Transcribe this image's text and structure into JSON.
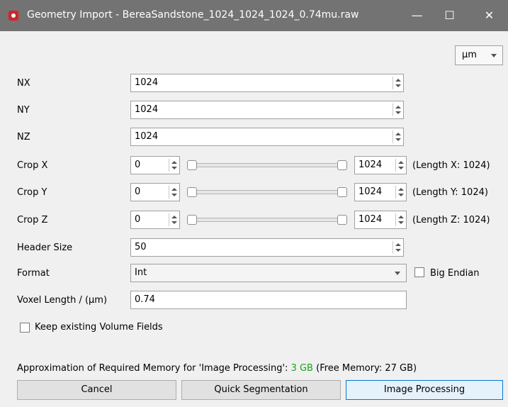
{
  "window": {
    "title": "Geometry Import - BereaSandstone_1024_1024_1024_0.74mu.raw",
    "minimize_glyph": "—",
    "maximize_glyph": "☐",
    "close_glyph": "✕"
  },
  "unit_select": {
    "value": "μm"
  },
  "dims": [
    {
      "label": "NX",
      "value": "1024"
    },
    {
      "label": "NY",
      "value": "1024"
    },
    {
      "label": "NZ",
      "value": "1024"
    }
  ],
  "crops": [
    {
      "label": "Crop X",
      "start": "0",
      "end": "1024",
      "length_text": "(Length X: 1024)",
      "range": [
        0,
        1024
      ],
      "max": 1024
    },
    {
      "label": "Crop Y",
      "start": "0",
      "end": "1024",
      "length_text": "(Length Y: 1024)",
      "range": [
        0,
        1024
      ],
      "max": 1024
    },
    {
      "label": "Crop Z",
      "start": "0",
      "end": "1024",
      "length_text": "(Length Z: 1024)",
      "range": [
        0,
        1024
      ],
      "max": 1024
    }
  ],
  "header": {
    "label": "Header Size",
    "value": "50"
  },
  "format": {
    "label": "Format",
    "value": "Int",
    "big_endian_label": "Big Endian",
    "big_endian_checked": false
  },
  "voxel": {
    "label": "Voxel Length / (μm)",
    "value": "0.74"
  },
  "keep_fields": {
    "label": "Keep existing Volume Fields",
    "checked": false
  },
  "memory": {
    "prefix": "Approximation of Required Memory for 'Image Processing':",
    "required": "3 GB",
    "free": "(Free Memory: 27 GB)"
  },
  "buttons": {
    "cancel": "Cancel",
    "quick_segmentation": "Quick Segmentation",
    "image_processing": "Image Processing"
  }
}
